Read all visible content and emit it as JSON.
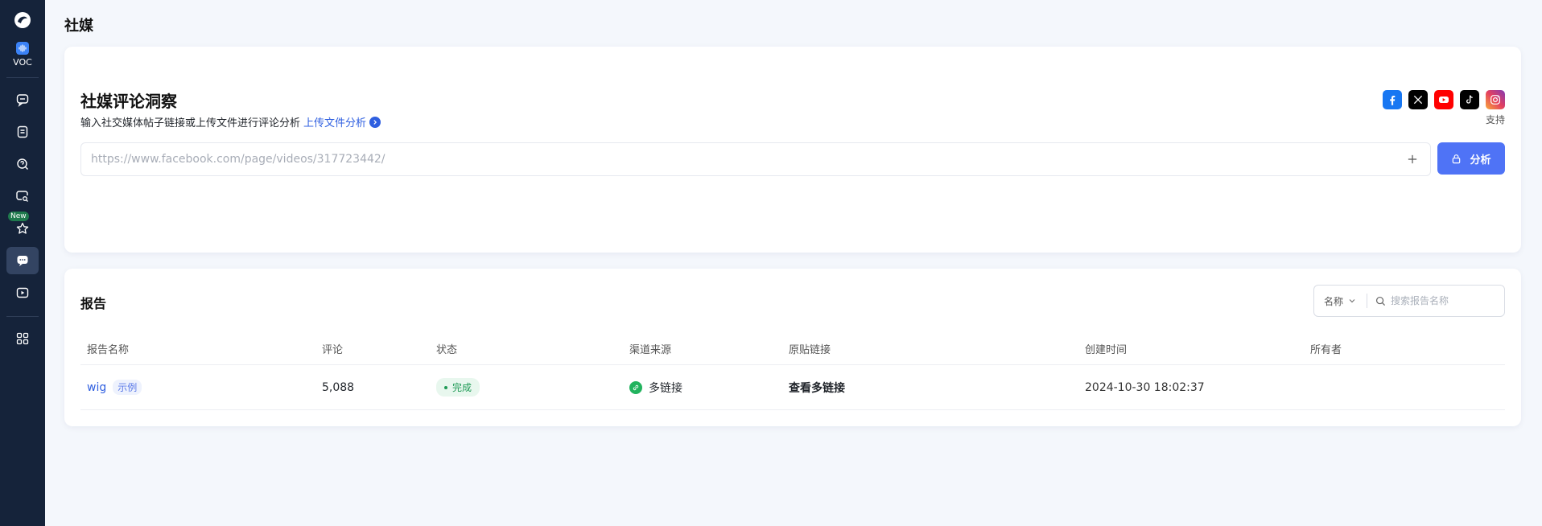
{
  "sidebar": {
    "voc_label": "VOC",
    "new_badge": "New",
    "items": [
      {
        "icon": "chat-icon"
      },
      {
        "icon": "notebook-icon"
      },
      {
        "icon": "search-question-icon"
      },
      {
        "icon": "chat-search-icon"
      },
      {
        "icon": "star-icon"
      },
      {
        "icon": "comment-icon",
        "active": true
      },
      {
        "icon": "video-play-icon"
      },
      {
        "icon": "grid-apps-icon"
      }
    ]
  },
  "page": {
    "title": "社媒"
  },
  "insight": {
    "title": "社媒评论洞察",
    "subtitle": "输入社交媒体帖子链接或上传文件进行评论分析",
    "upload_link": "上传文件分析",
    "support_label": "支持",
    "platforms": [
      "facebook-icon",
      "x-icon",
      "youtube-icon",
      "tiktok-icon",
      "instagram-icon"
    ],
    "url_placeholder": "https://www.facebook.com/page/videos/317723442/",
    "analyze_label": "分析"
  },
  "reports": {
    "title": "报告",
    "filter_field": "名称",
    "search_placeholder": "搜索报告名称",
    "columns": [
      "报告名称",
      "评论",
      "状态",
      "渠道来源",
      "原贴链接",
      "创建时间",
      "所有者"
    ],
    "rows": [
      {
        "name": "wig",
        "tag": "示例",
        "comments": "5,088",
        "status": "完成",
        "channel": "多链接",
        "link": "查看多链接",
        "created": "2024-10-30 18:02:37",
        "owner": ""
      }
    ]
  },
  "colors": {
    "sidebar_bg": "#15233a",
    "accent": "#4f73f6",
    "link": "#2f5fe0",
    "success": "#1e9a55"
  }
}
